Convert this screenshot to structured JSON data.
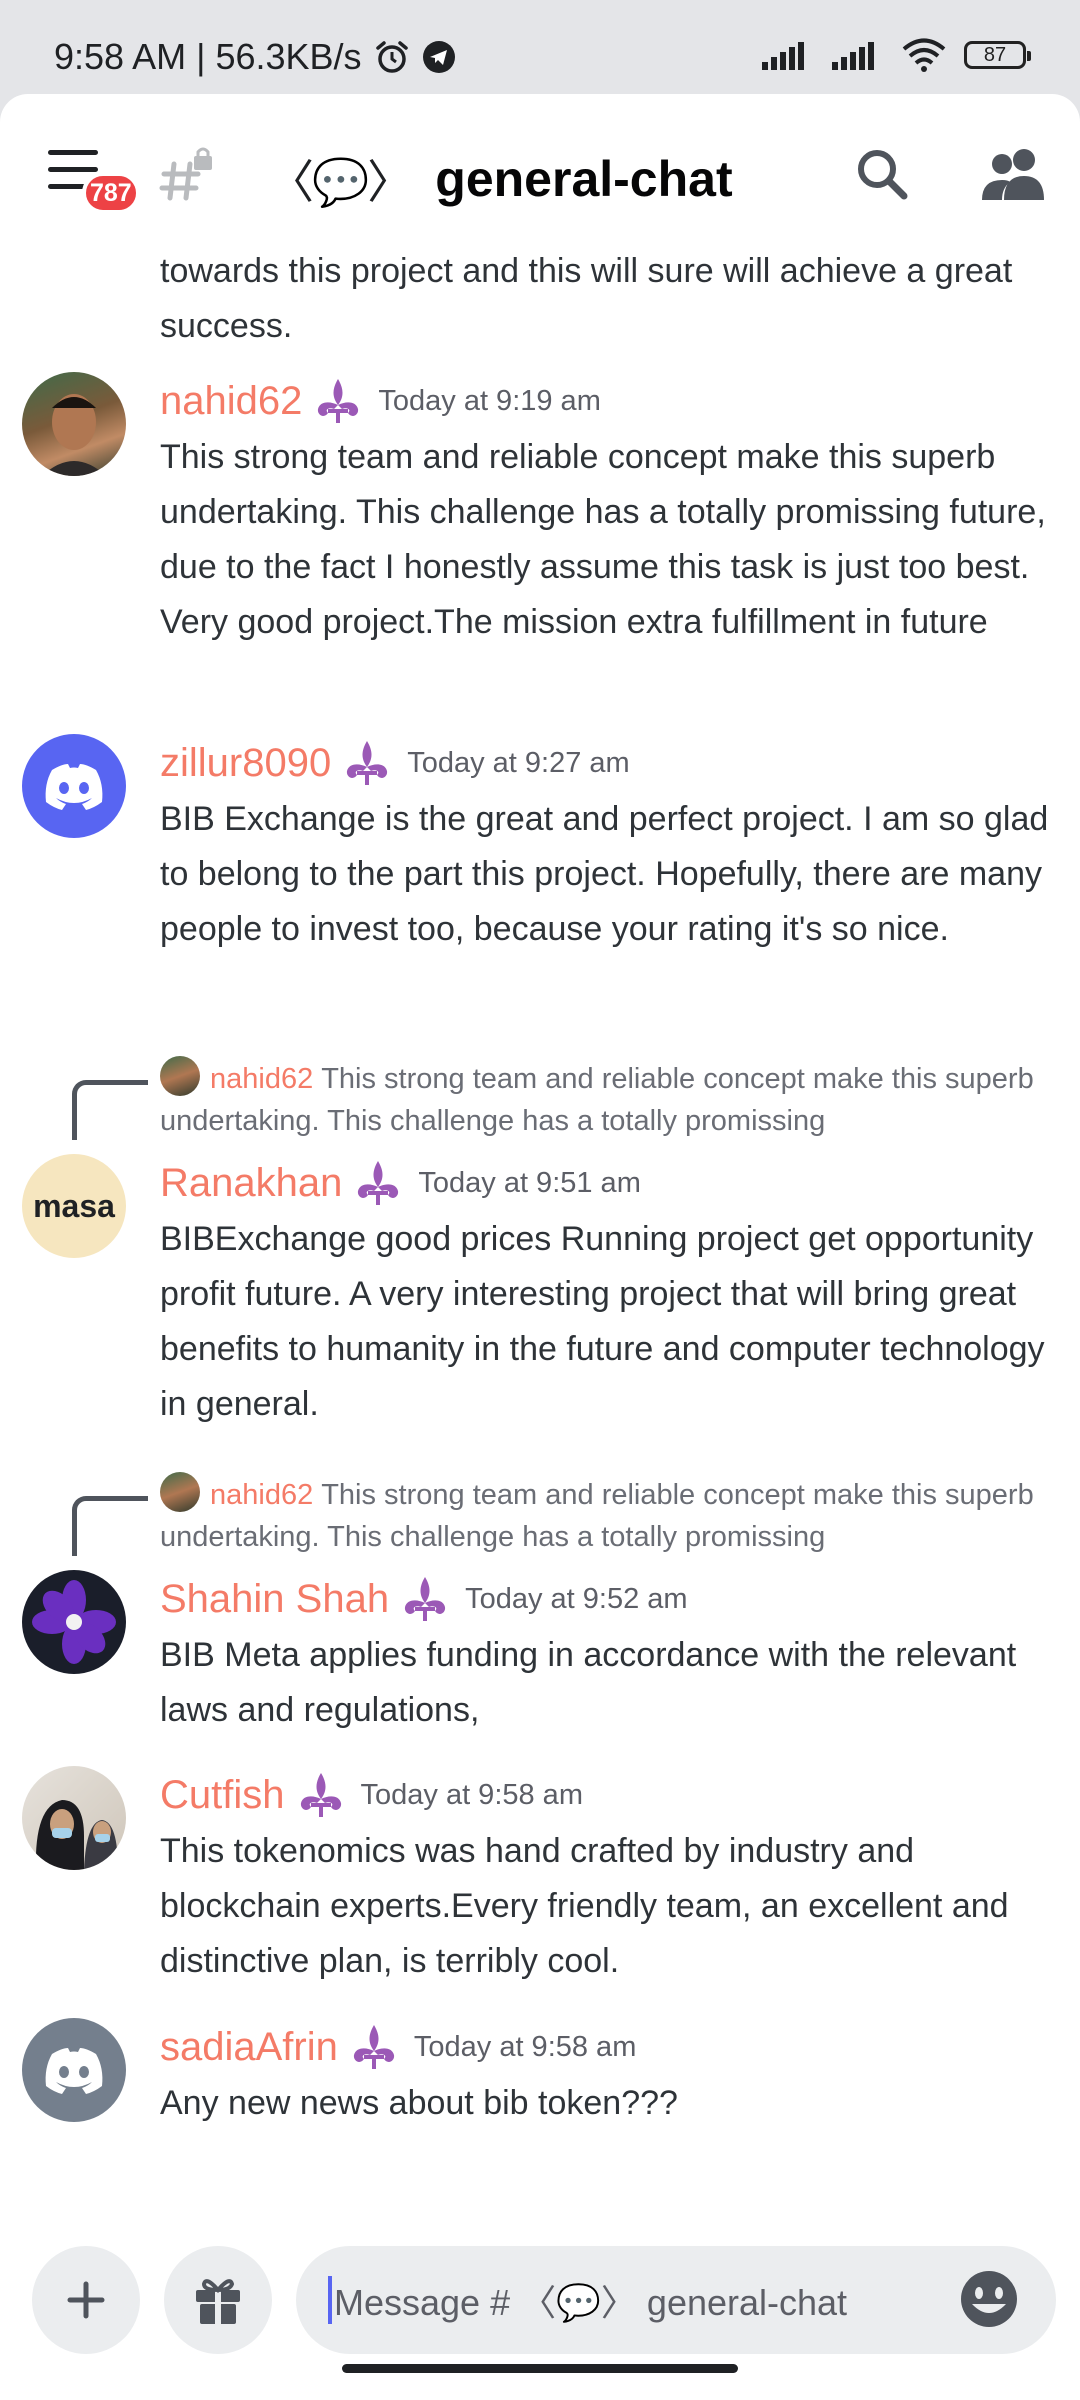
{
  "status_bar": {
    "text": "9:58 AM | 56.3KB/s",
    "battery": "87"
  },
  "header": {
    "unread_badge": "787",
    "channel_emoji": "〈💬〉",
    "channel_name": "general-chat"
  },
  "messages": {
    "continuation": {
      "text": "towards this project and this will sure will achieve a great success."
    },
    "m1": {
      "username": "nahid62",
      "timestamp": "Today at 9:19 am",
      "text": "This strong team and reliable concept make this superb undertaking. This challenge has a totally promissing future, due to the fact I honestly assume this task is just too best. Very good project.The mission extra fulfillment in future"
    },
    "m2": {
      "username": "zillur8090",
      "timestamp": "Today at 9:27 am",
      "text": "BIB Exchange is the great and perfect project. I am so glad to belong to the part this project. Hopefully, there are many people to invest too, because your rating it's so nice."
    },
    "m3": {
      "reply_user": "nahid62",
      "reply_text": "This strong team and reliable concept make this superb undertaking. This challenge has a totally promissing",
      "avatar_text": "masa",
      "username": "Ranakhan",
      "timestamp": "Today at 9:51 am",
      "text": "BIBExchange good prices Running project get opportunity profit future. A very interesting project that will bring great benefits to humanity in the future and computer technology in general."
    },
    "m4": {
      "reply_user": "nahid62",
      "reply_text": "This strong team and reliable concept make this superb undertaking. This challenge has a totally promissing",
      "username": "Shahin Shah",
      "timestamp": "Today at 9:52 am",
      "text": "BIB Meta applies funding in accordance with the relevant laws and regulations,"
    },
    "m5": {
      "username": "Cutfish",
      "timestamp": "Today at 9:58 am",
      "text": "This tokenomics was hand crafted by industry and blockchain experts.Every  friendly team, an excellent and distinctive plan, is terribly cool."
    },
    "m6": {
      "username": "sadiaAfrin",
      "timestamp": "Today at 9:58 am",
      "text": "Any new news about bib token???"
    }
  },
  "composer": {
    "placeholder": "Message # 〈💬〉 general-chat"
  },
  "colors": {
    "username": "#f47b67",
    "flair": "#9b59b6",
    "discord_blurple": "#5865f2",
    "badge": "#ed4245"
  },
  "icons": [
    "alarm-icon",
    "telegram-icon",
    "signal-icon",
    "wifi-icon",
    "battery-icon",
    "menu-icon",
    "thread-lock-icon",
    "search-icon",
    "members-icon",
    "fleur-de-lis-icon",
    "discord-logo-icon",
    "plus-icon",
    "gift-icon",
    "emoji-icon"
  ]
}
